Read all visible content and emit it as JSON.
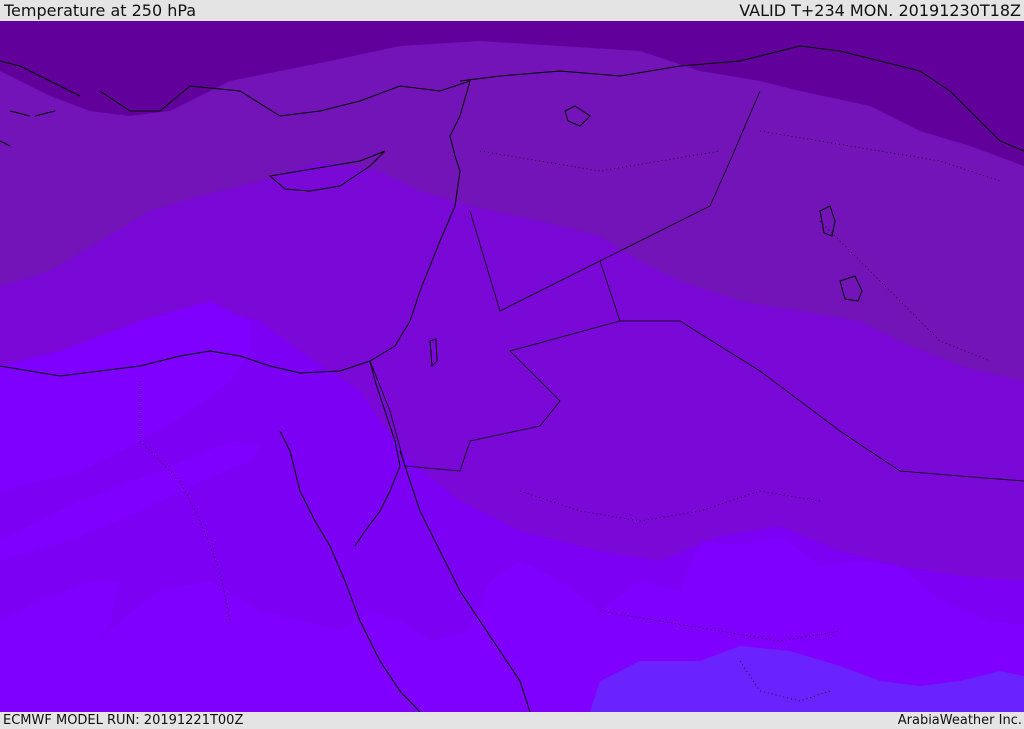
{
  "header": {
    "title": "Temperature at 250 hPa",
    "valid": "VALID T+234 MON. 20191230T18Z"
  },
  "footer": {
    "model_run": "ECMWF MODEL RUN: 20191221T00Z",
    "credit": "ArabiaWeather Inc."
  },
  "map": {
    "colors": {
      "band_coldest": "#62009c",
      "band_cold": "#7214b8",
      "band_mid": "#7a08d6",
      "band_warm": "#7c00f4",
      "band_warmest": "#8000ff",
      "band_south": "#6a22ff",
      "coastline": "#000000"
    }
  }
}
